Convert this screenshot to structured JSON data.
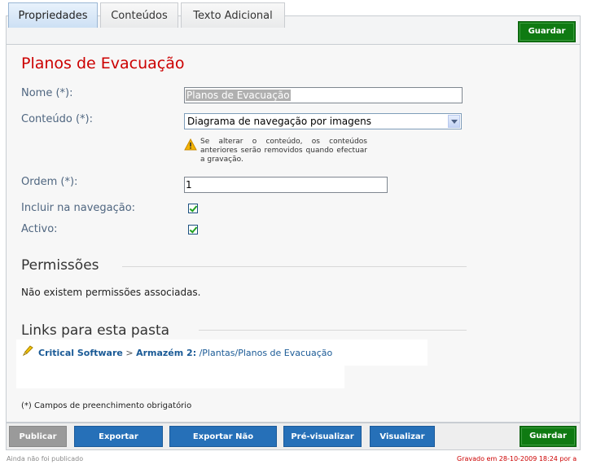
{
  "tabs": [
    {
      "label": "Propriedades",
      "active": true
    },
    {
      "label": "Conteúdos",
      "active": false
    },
    {
      "label": "Texto Adicional",
      "active": false
    }
  ],
  "save_label": "Guardar",
  "page_title": "Planos de Evacuação",
  "form": {
    "name_label": "Nome (*):",
    "name_value": "Planos de Evacuação",
    "content_label": "Conteúdo (*):",
    "content_value": "Diagrama de navegação por imagens",
    "content_warning": "Se alterar o conteúdo, os conteúdos anteriores serão removidos quando efectuar a gravação.",
    "order_label": "Ordem (*):",
    "order_value": "1",
    "nav_label": "Incluir na navegação:",
    "nav_checked": true,
    "active_label": "Activo:",
    "active_checked": true
  },
  "permissions": {
    "title": "Permissões",
    "empty_text": "Não existem permissões associadas."
  },
  "links": {
    "title": "Links para esta pasta",
    "crumb_1": "Critical Software",
    "separator": ">",
    "crumb_2": "Armazém 2:",
    "crumb_path": " /Plantas/Planos de Evacuação"
  },
  "footnote": "(*) Campos de preenchimento obrigatório",
  "actions": {
    "publish": "Publicar",
    "export_published": "Exportar Publicado",
    "export_unpublished": "Exportar Não Publicado",
    "preview": "Pré-visualizar",
    "view": "Visualizar",
    "save": "Guardar"
  },
  "status": {
    "left": "Ainda não foi publicado",
    "right": "Gravado em 28-10-2009 18:24 por a"
  },
  "colors": {
    "title_red": "#cc0000",
    "save_green": "#0f7a12",
    "action_blue": "#2670b8",
    "publish_grey": "#9a9a9a"
  }
}
